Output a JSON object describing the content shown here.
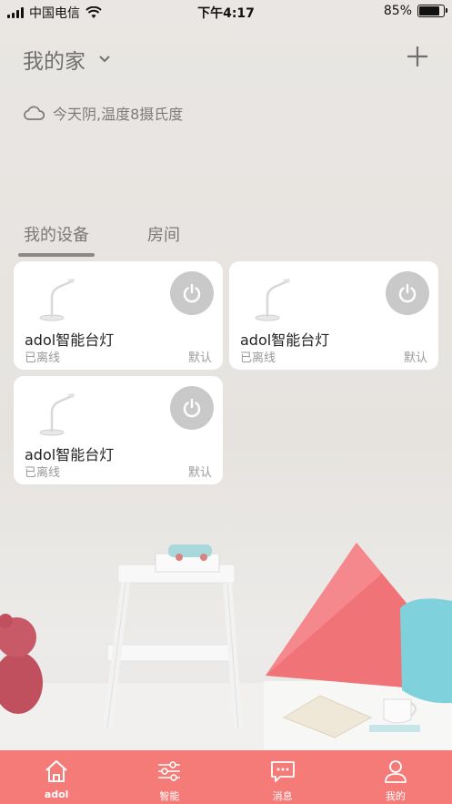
{
  "status_bar": {
    "carrier": "中国电信",
    "time": "下午4:17",
    "battery_percent": "85%",
    "battery_level": 0.85
  },
  "header": {
    "home_name": "我的家",
    "weather_text": "今天阴,温度8摄氏度"
  },
  "tabs": [
    {
      "label": "我的设备",
      "active": true
    },
    {
      "label": "房间",
      "active": false
    }
  ],
  "devices": [
    {
      "name": "adol智能台灯",
      "status": "已离线",
      "room": "默认"
    },
    {
      "name": "adol智能台灯",
      "status": "已离线",
      "room": "默认"
    },
    {
      "name": "adol智能台灯",
      "status": "已离线",
      "room": "默认"
    }
  ],
  "bottom_nav": [
    {
      "label": "adol",
      "icon": "home-icon",
      "active": true
    },
    {
      "label": "智能",
      "icon": "sliders-icon",
      "active": false
    },
    {
      "label": "消息",
      "icon": "message-icon",
      "active": false
    },
    {
      "label": "我的",
      "icon": "user-icon",
      "active": false
    }
  ],
  "colors": {
    "nav_background": "#f57b78",
    "power_button": "#c9c9c9",
    "card_background": "#ffffff"
  }
}
